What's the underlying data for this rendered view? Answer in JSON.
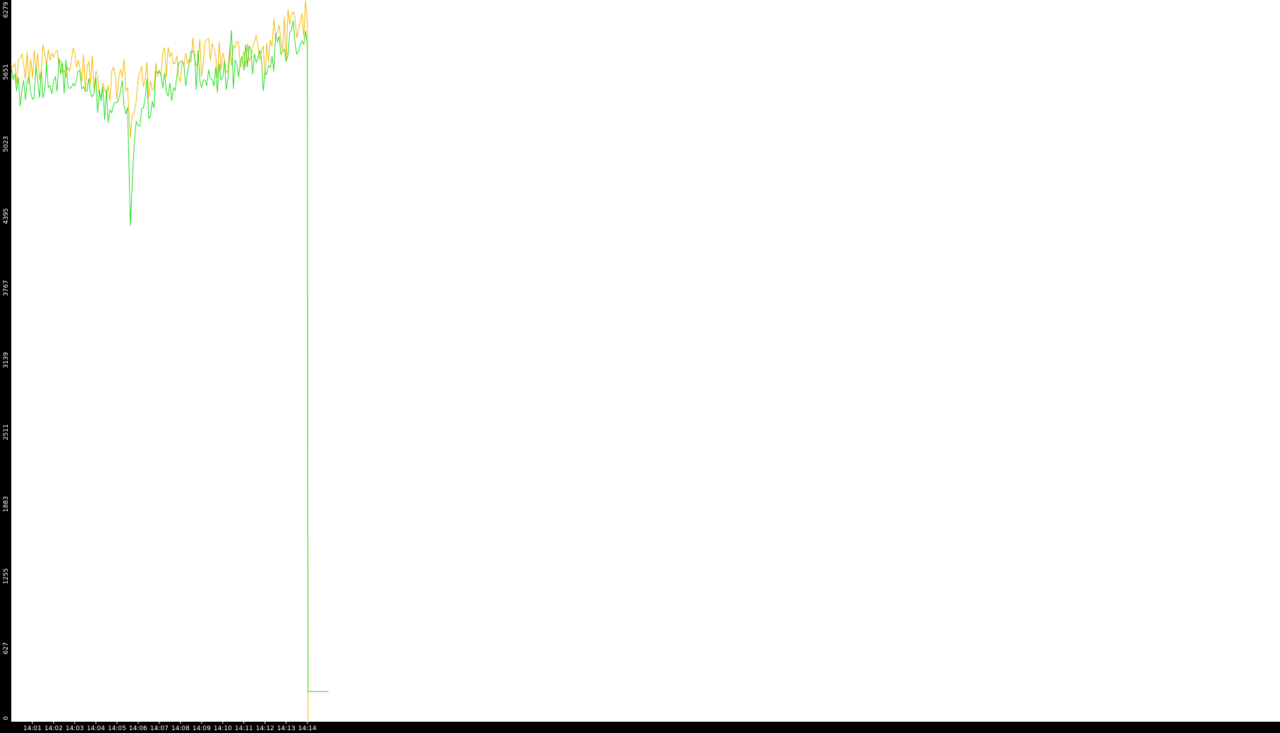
{
  "chart_data": {
    "type": "line",
    "title": "",
    "xlabel": "",
    "ylabel": "",
    "background": "#ffffff",
    "axis_band_color": "#000000",
    "tick_label_color": "#ffffff",
    "grid": false,
    "legend": "none",
    "x_tick_labels": [
      "14:01",
      "14:02",
      "14:03",
      "14:04",
      "14:05",
      "14:06",
      "14:07",
      "14:08",
      "14:09",
      "14:10",
      "14:11",
      "14:12",
      "14:13",
      "14:14"
    ],
    "y_tick_labels": [
      "0",
      "627",
      "1255",
      "1883",
      "2511",
      "3139",
      "3767",
      "4395",
      "5023",
      "5651",
      "6279"
    ],
    "ylim": [
      0,
      6279
    ],
    "x_range_minutes": [
      14.0,
      15.0
    ],
    "series": [
      {
        "color": "#f5b800",
        "x": [
          "14:00:00",
          "14:00:30",
          "14:01:00",
          "14:01:30",
          "14:02:00",
          "14:02:30",
          "14:03:00",
          "14:03:30",
          "14:04:00",
          "14:04:30",
          "14:05:00",
          "14:05:30",
          "14:05:38",
          "14:06:00",
          "14:06:30",
          "14:07:00",
          "14:07:30",
          "14:08:00",
          "14:08:30",
          "14:09:00",
          "14:09:30",
          "14:10:00",
          "14:10:30",
          "14:11:00",
          "14:11:30",
          "14:12:00",
          "14:12:30",
          "14:13:00",
          "14:13:30",
          "14:14:00",
          "14:14:02"
        ],
        "values": [
          5640,
          5700,
          5680,
          5720,
          5750,
          5800,
          5720,
          5650,
          5600,
          5560,
          5600,
          5620,
          5100,
          5580,
          5600,
          5680,
          5700,
          5740,
          5800,
          5780,
          5760,
          5740,
          5780,
          5840,
          5880,
          5760,
          5980,
          6010,
          6080,
          6100,
          0
        ]
      },
      {
        "color": "#22dd22",
        "x": [
          "14:00:00",
          "14:00:30",
          "14:01:00",
          "14:01:30",
          "14:02:00",
          "14:02:30",
          "14:03:00",
          "14:03:30",
          "14:04:00",
          "14:04:30",
          "14:05:00",
          "14:05:30",
          "14:05:38",
          "14:06:00",
          "14:06:30",
          "14:07:00",
          "14:07:30",
          "14:08:00",
          "14:08:30",
          "14:09:00",
          "14:09:30",
          "14:10:00",
          "14:10:30",
          "14:11:00",
          "14:11:30",
          "14:12:00",
          "14:12:30",
          "14:13:00",
          "14:13:30",
          "14:14:00",
          "14:14:02",
          "14:14:02",
          "14:15:00"
        ],
        "values": [
          5540,
          5520,
          5560,
          5600,
          5640,
          5620,
          5540,
          5500,
          5440,
          5380,
          5420,
          5430,
          4480,
          5350,
          5420,
          5520,
          5560,
          5620,
          5700,
          5640,
          5620,
          5600,
          5640,
          5720,
          5760,
          5620,
          5860,
          5880,
          5960,
          5980,
          3000,
          250,
          250
        ]
      }
    ]
  }
}
